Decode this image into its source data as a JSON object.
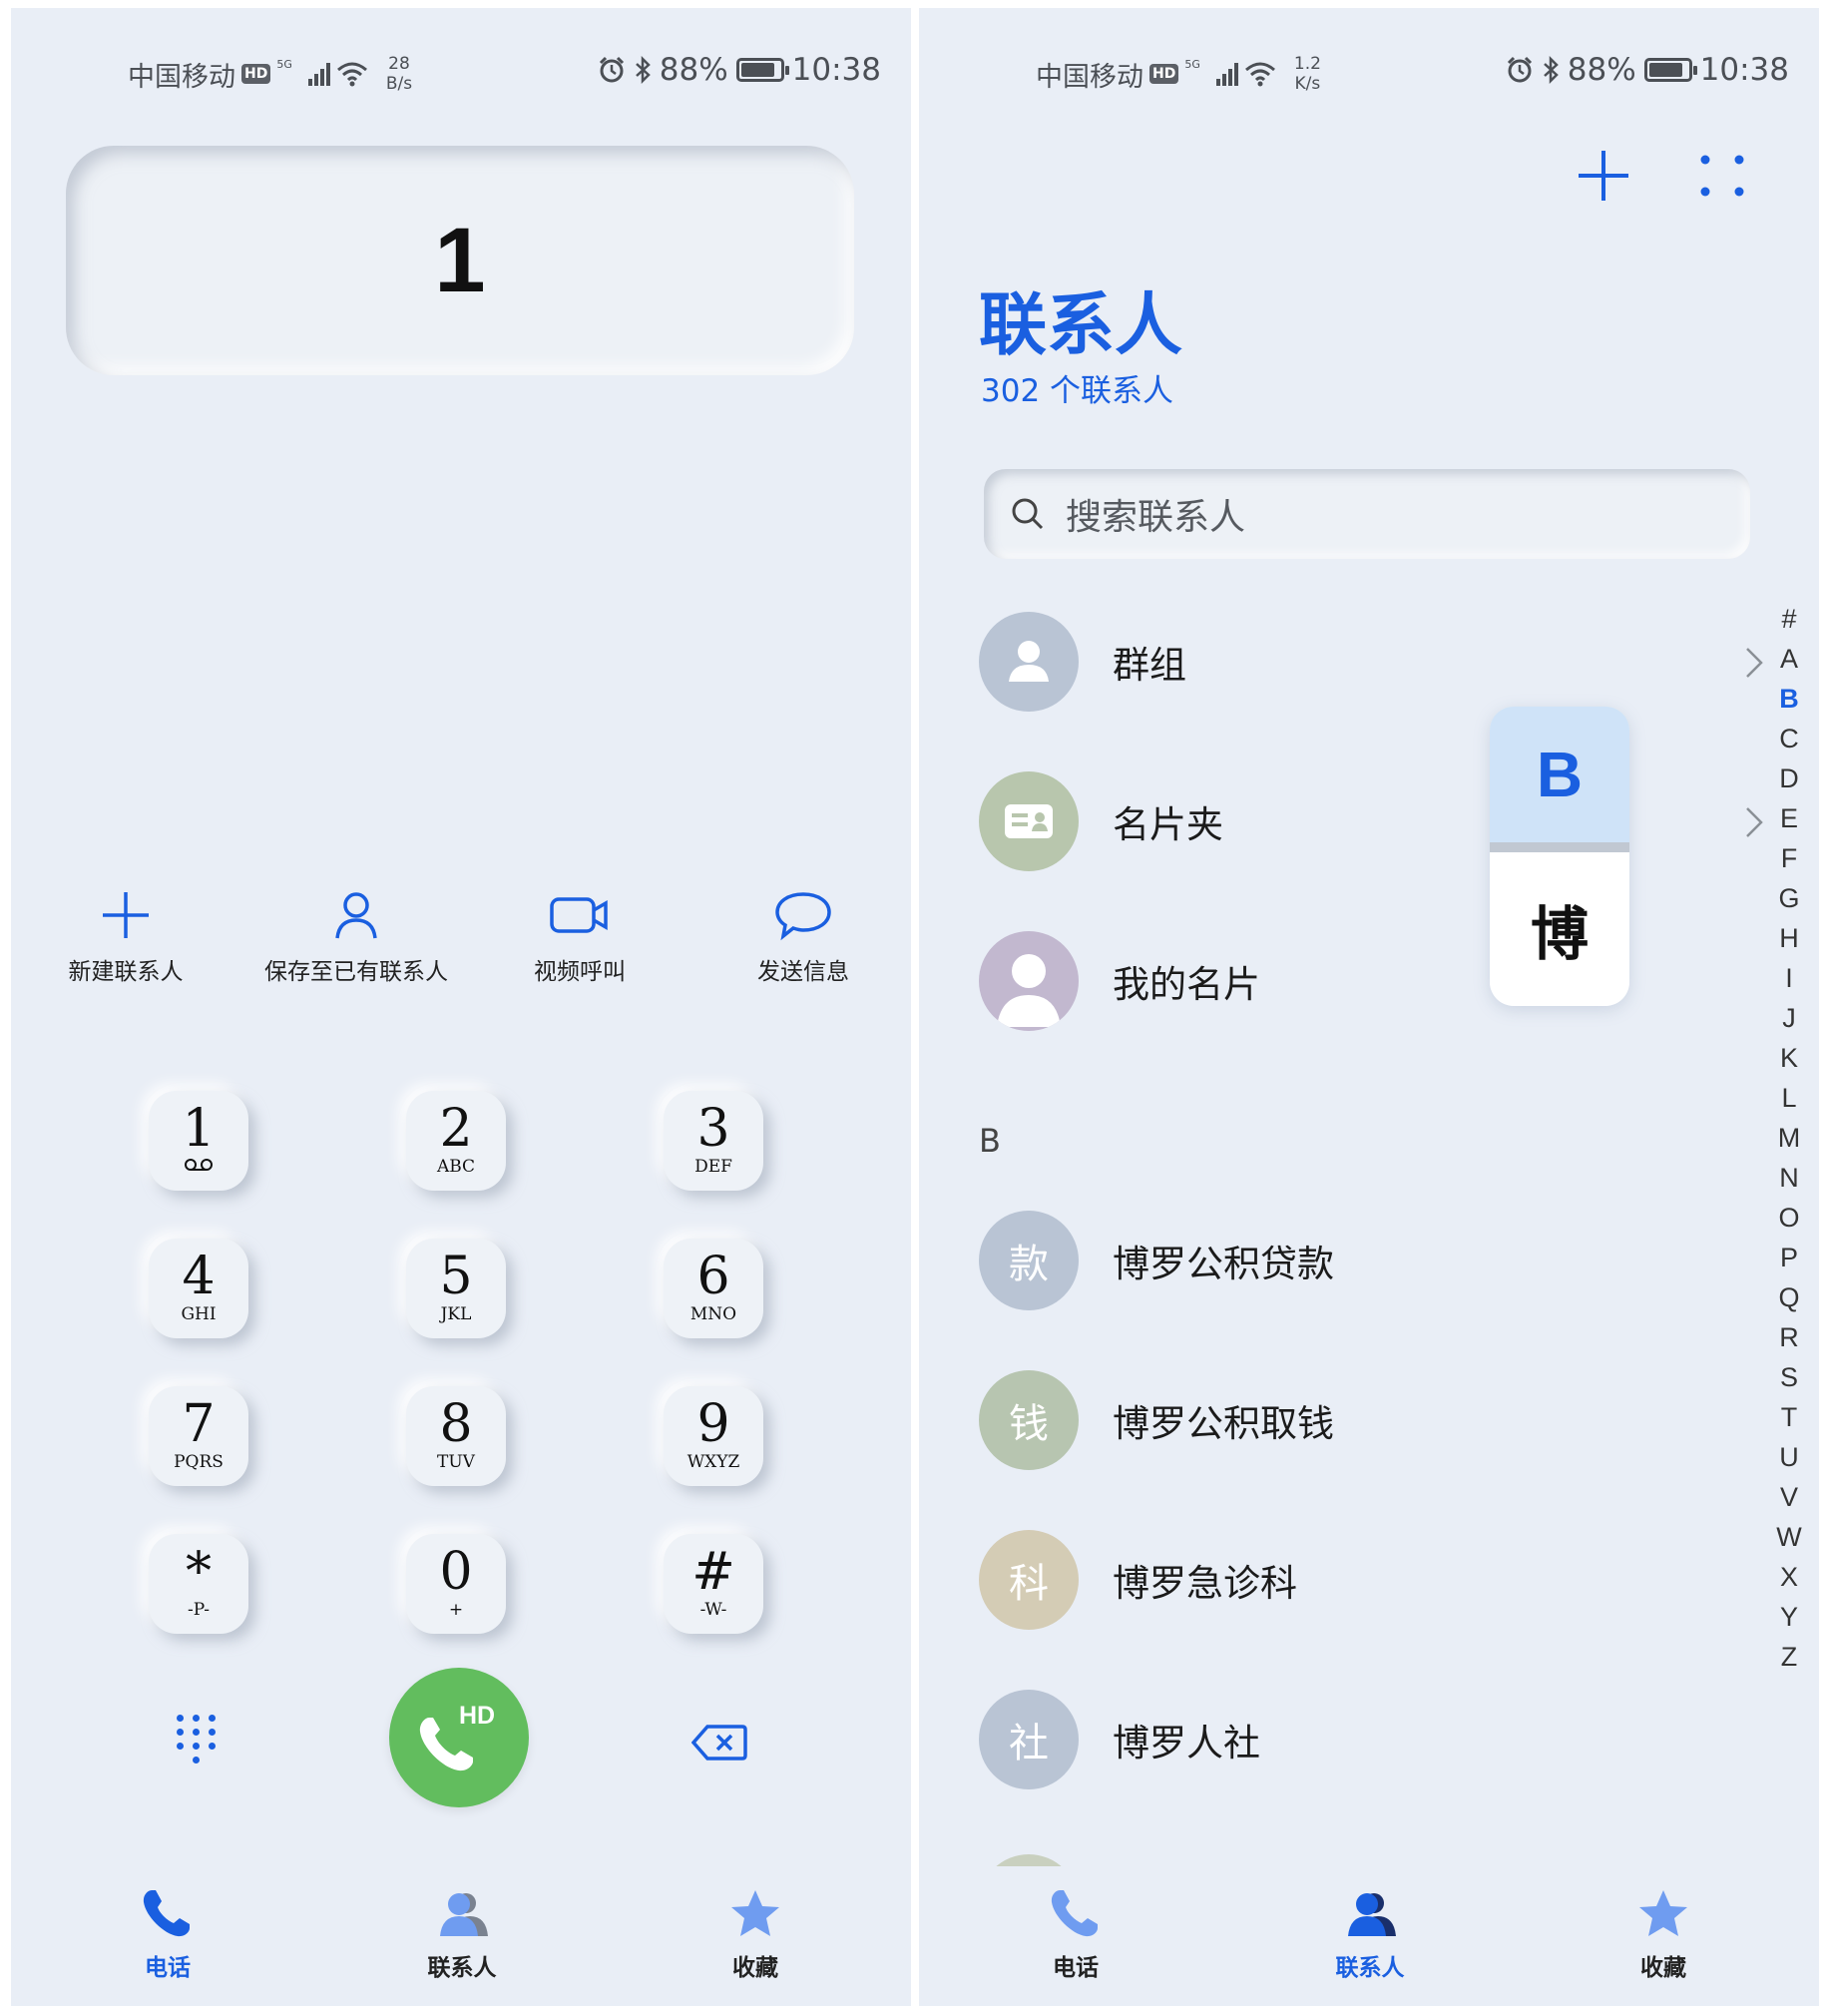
{
  "left": {
    "status": {
      "carrier": "中国移动",
      "hd": "HD",
      "net": "5G",
      "speed_value": "28",
      "speed_unit": "B/s",
      "battery": "88%",
      "time": "10:38"
    },
    "display_number": "1",
    "actions": [
      {
        "label": "新建联系人",
        "icon": "add-icon"
      },
      {
        "label": "保存至已有联系人",
        "icon": "person-icon"
      },
      {
        "label": "视频呼叫",
        "icon": "video-call-icon"
      },
      {
        "label": "发送信息",
        "icon": "message-bubble-icon"
      }
    ],
    "keys": [
      {
        "digit": "1",
        "letters": ""
      },
      {
        "digit": "2",
        "letters": "ABC"
      },
      {
        "digit": "3",
        "letters": "DEF"
      },
      {
        "digit": "4",
        "letters": "GHI"
      },
      {
        "digit": "5",
        "letters": "JKL"
      },
      {
        "digit": "6",
        "letters": "MNO"
      },
      {
        "digit": "7",
        "letters": "PQRS"
      },
      {
        "digit": "8",
        "letters": "TUV"
      },
      {
        "digit": "9",
        "letters": "WXYZ"
      },
      {
        "digit": "*",
        "letters": "-P-"
      },
      {
        "digit": "0",
        "letters": "+"
      },
      {
        "digit": "#",
        "letters": "-W-"
      }
    ],
    "call_hd": "HD",
    "nav": [
      {
        "label": "电话",
        "active": true
      },
      {
        "label": "联系人",
        "active": false
      },
      {
        "label": "收藏",
        "active": false
      }
    ]
  },
  "right": {
    "status": {
      "carrier": "中国移动",
      "hd": "HD",
      "net": "5G",
      "speed_value": "1.2",
      "speed_unit": "K/s",
      "battery": "88%",
      "time": "10:38"
    },
    "title": "联系人",
    "count": "302 个联系人",
    "search_placeholder": "搜索联系人",
    "special_rows": [
      {
        "name": "群组",
        "avatar_color": "#b9c4d4",
        "icon": "group-avatar-icon",
        "chevron": true
      },
      {
        "name": "名片夹",
        "avatar_color": "#b8c6ad",
        "icon": "business-card-icon",
        "chevron": true
      },
      {
        "name": "我的名片",
        "avatar_color": "#c2b8cf",
        "icon": "my-profile-avatar-icon",
        "chevron": false
      }
    ],
    "section": "B",
    "contacts": [
      {
        "name": "博罗公积贷款",
        "avatar_char": "款",
        "avatar_color": "#b9c4d4"
      },
      {
        "name": "博罗公积取钱",
        "avatar_char": "钱",
        "avatar_color": "#b7c5b0"
      },
      {
        "name": "博罗急诊科",
        "avatar_char": "科",
        "avatar_color": "#d4ccb5"
      },
      {
        "name": "博罗人社",
        "avatar_char": "社",
        "avatar_color": "#b9c4d4"
      }
    ],
    "index_popup": {
      "letter": "B",
      "char": "博"
    },
    "alphabet": [
      "#",
      "A",
      "B",
      "C",
      "D",
      "E",
      "F",
      "G",
      "H",
      "I",
      "J",
      "K",
      "L",
      "M",
      "N",
      "O",
      "P",
      "Q",
      "R",
      "S",
      "T",
      "U",
      "V",
      "W",
      "X",
      "Y",
      "Z"
    ],
    "alphabet_selected": "B",
    "nav": [
      {
        "label": "电话",
        "active": false
      },
      {
        "label": "联系人",
        "active": true
      },
      {
        "label": "收藏",
        "active": false
      }
    ]
  },
  "colors": {
    "accent": "#1a5fe0",
    "call_green": "#62bd5e",
    "background": "#e9eef6"
  }
}
